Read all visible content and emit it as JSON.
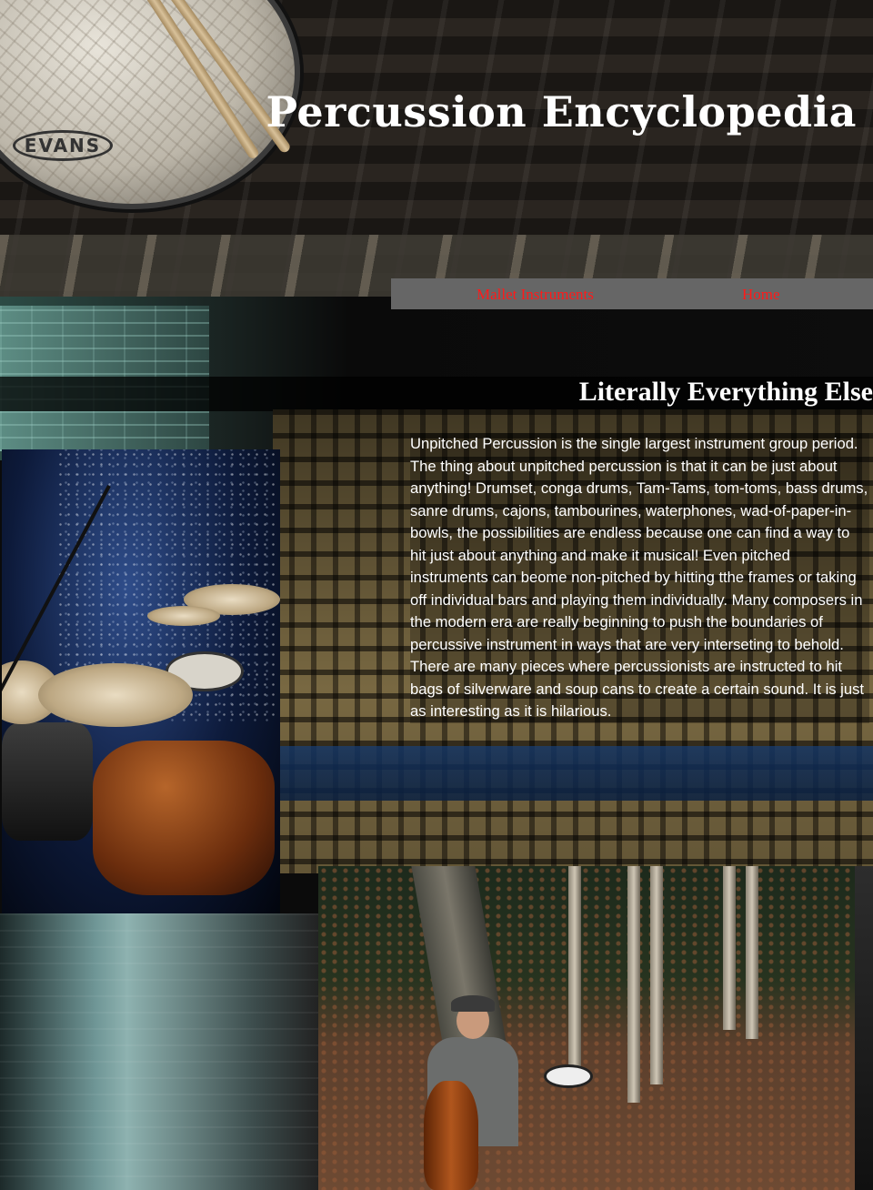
{
  "site": {
    "title": "Percussion Encyclopedia",
    "drum_logo_text": "EVANS"
  },
  "nav": {
    "items": [
      {
        "label": "Mallet Instruments"
      },
      {
        "label": "Home"
      }
    ],
    "link_color": "#ff1a1a",
    "bar_color": "#666666"
  },
  "section": {
    "heading": "Literally Everything Else",
    "body": "Unpitched Percussion is the single largest instrument group period. The thing about unpitched percussion is that it can be just about anything! Drumset, conga drums, Tam-Tams, tom-toms, bass drums, sanre drums, cajons, tambourines, waterphones, wad-of-paper-in-bowls, the possibilities are endless because one can find a way to hit just about anything and make it musical! Even pitched instruments can beome non-pitched by hitting tthe frames or taking off individual bars and playing them individually. Many composers in the modern era are really beginning to push the boundaries of percussive instrument in ways that are very interseting to behold. There are many pieces where percussionists are instructed to hit bags of silverware and soup cans to create a certain sound. It is just as interesting as it is hilarious."
  },
  "photos": {
    "drumkit": {
      "icon": "drumkit-photo"
    },
    "conga": {
      "icon": "conga-player-photo"
    }
  }
}
